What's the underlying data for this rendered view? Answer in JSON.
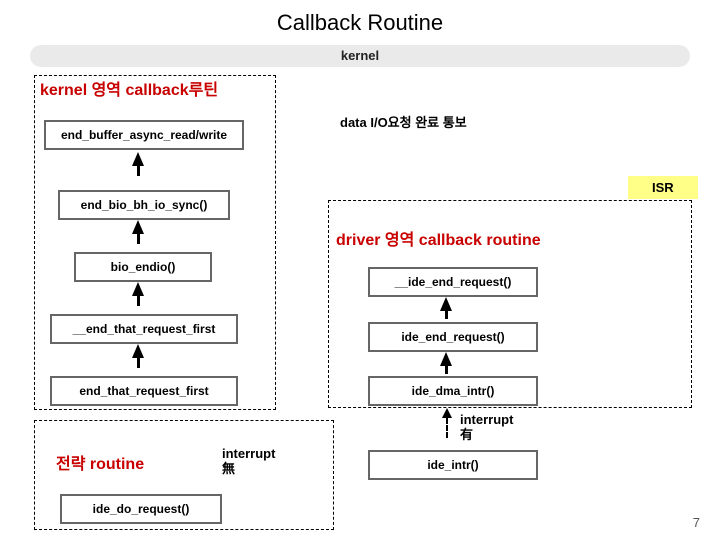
{
  "title": "Callback Routine",
  "bar_label": "kernel",
  "sections": {
    "kernel_area": "kernel 영역 callback루틴",
    "driver_area": "driver 영역 callback routine",
    "forward": "전략 routine"
  },
  "notes": {
    "io_complete": "data I/O요청 완료 통보",
    "interrupt_yes": "interrupt 有",
    "interrupt_no": "interrupt 無"
  },
  "boxes": {
    "b1": "end_buffer_async_read/write",
    "b2": "end_bio_bh_io_sync()",
    "b3": "bio_endio()",
    "b4": "__end_that_request_first",
    "b5": "end_that_request_first",
    "b6": "__ide_end_request()",
    "b7": "ide_end_request()",
    "b8": "ide_dma_intr()",
    "b9": "ide_intr()",
    "b10": "ide_do_request()"
  },
  "isr_label": "ISR",
  "page_number": "7"
}
